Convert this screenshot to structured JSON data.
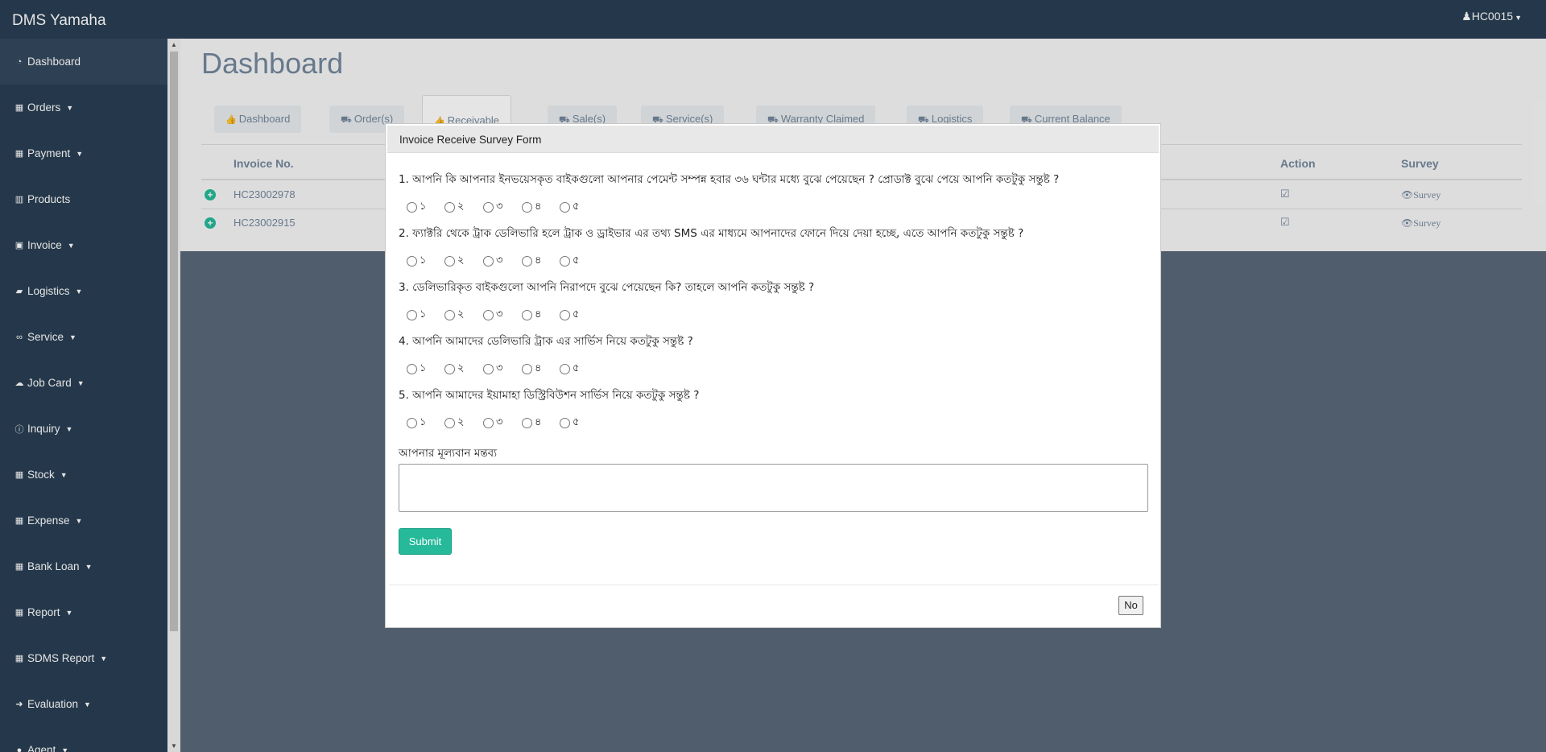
{
  "app": {
    "brand": "DMS Yamaha",
    "user": "HC0015"
  },
  "sidebar": {
    "items": [
      {
        "label": "Dashboard",
        "icon": "dashboard-icon",
        "glyph": "◔",
        "caret": false
      },
      {
        "label": "Orders",
        "icon": "table-icon",
        "glyph": "▦",
        "caret": true
      },
      {
        "label": "Payment",
        "icon": "table-icon",
        "glyph": "▦",
        "caret": true
      },
      {
        "label": "Products",
        "icon": "bar-chart-icon",
        "glyph": "▥",
        "caret": false
      },
      {
        "label": "Invoice",
        "icon": "money-icon",
        "glyph": "▣",
        "caret": true
      },
      {
        "label": "Logistics",
        "icon": "truck-icon",
        "glyph": "▰",
        "caret": true
      },
      {
        "label": "Service",
        "icon": "link-icon",
        "glyph": "∞",
        "caret": true
      },
      {
        "label": "Job Card",
        "icon": "cloud-icon",
        "glyph": "☁",
        "caret": true
      },
      {
        "label": "Inquiry",
        "icon": "info-icon",
        "glyph": "ⓘ",
        "caret": true
      },
      {
        "label": "Stock",
        "icon": "calculator-icon",
        "glyph": "▦",
        "caret": true
      },
      {
        "label": "Expense",
        "icon": "calculator-icon",
        "glyph": "▦",
        "caret": true
      },
      {
        "label": "Bank Loan",
        "icon": "calculator-icon",
        "glyph": "▦",
        "caret": true
      },
      {
        "label": "Report",
        "icon": "table-icon",
        "glyph": "▦",
        "caret": true
      },
      {
        "label": "SDMS Report",
        "icon": "table-icon",
        "glyph": "▦",
        "caret": true
      },
      {
        "label": "Evaluation",
        "icon": "sign-out-icon",
        "glyph": "➜",
        "caret": true
      },
      {
        "label": "Agent",
        "icon": "user-icon",
        "glyph": "●",
        "caret": true
      }
    ]
  },
  "main": {
    "title": "Dashboard",
    "tabs": [
      {
        "label": "Dashboard",
        "glyph": "👍"
      },
      {
        "label": "Order(s)",
        "glyph": "⛟"
      },
      {
        "label": "Receivable",
        "glyph": "👍"
      },
      {
        "label": "Sale(s)",
        "glyph": "⛟"
      },
      {
        "label": "Service(s)",
        "glyph": "⛟"
      },
      {
        "label": "Warranty Claimed",
        "glyph": "⛟"
      },
      {
        "label": "Logistics",
        "glyph": "⛟"
      },
      {
        "label": "Current Balance",
        "glyph": "⛟"
      }
    ],
    "table": {
      "headers": [
        "Invoice No.",
        "Action",
        "Survey"
      ],
      "rows": [
        {
          "invoice": "HC23002978",
          "survey": "Survey"
        },
        {
          "invoice": "HC23002915",
          "survey": "Survey"
        }
      ]
    }
  },
  "modal": {
    "title": "Invoice Receive Survey Form",
    "questions": [
      "1. আপনি কি আপনার ইনভয়েসকৃত বাইকগুলো আপনার পেমেন্ট সম্পন্ন হবার ৩৬ ঘন্টার মধ্যে বুঝে পেয়েছেন ? প্রোডাক্ট বুঝে পেয়ে আপনি কতটুকু সন্তুষ্ট ?",
      "2. ফ্যাক্টরি থেকে ট্রাক ডেলিভারি হলে ট্রাক ও ড্রাইভার এর তথ্য SMS এর মাধ্যমে আপনাদের ফোনে দিয়ে দেয়া হচ্ছে, এতে আপনি কতটুকু সন্তুষ্ট ?",
      "3. ডেলিভারিকৃত বাইকগুলো আপনি নিরাপদে বুঝে পেয়েছেন কি? তাহলে আপনি কতটুকু সন্তুষ্ট ?",
      "4. আপনি আমাদের ডেলিভারি ট্রাক এর সার্ভিস নিয়ে কতটুকু সন্তুষ্ট ?",
      "5. আপনি আমাদের ইয়ামাহা ডিস্ট্রিবিউশন সার্ভিস নিয়ে কতটুকু সন্তুষ্ট ?"
    ],
    "options": [
      "১",
      "২",
      "৩",
      "৪",
      "৫"
    ],
    "comment_label": "আপনার মূল্যবান মন্তব্য",
    "submit_label": "Submit",
    "no_label": "No"
  }
}
